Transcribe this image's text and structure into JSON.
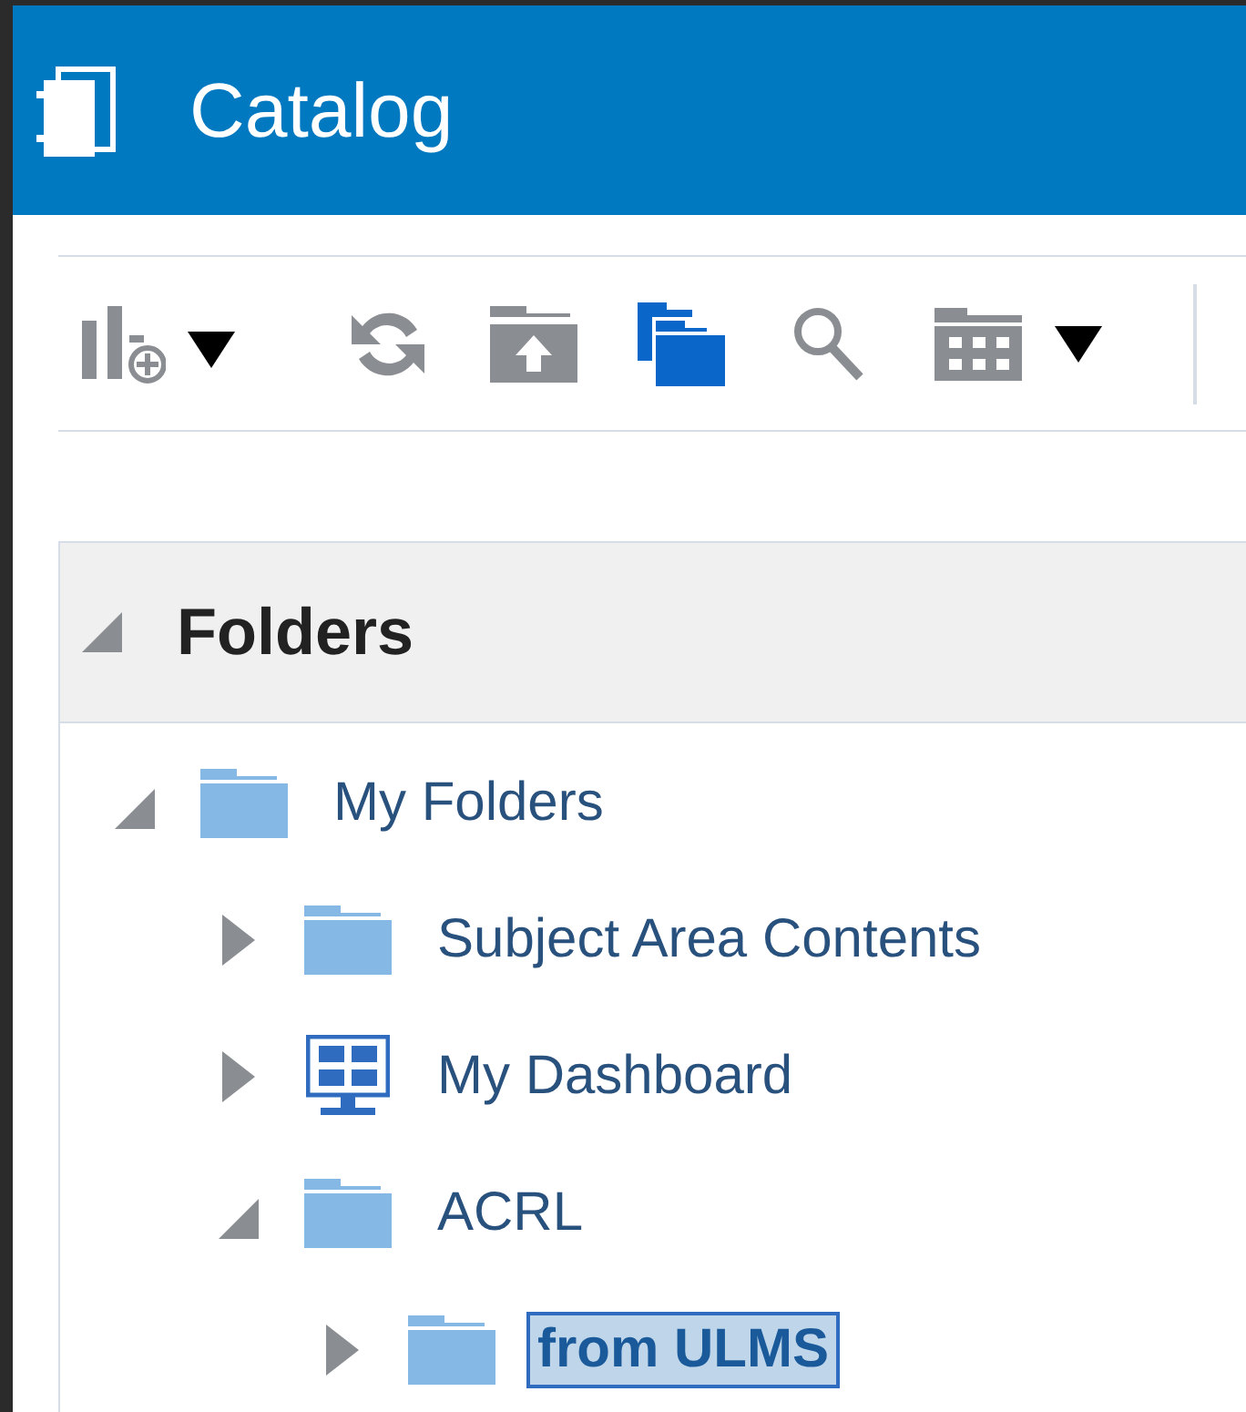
{
  "header": {
    "title": "Catalog"
  },
  "panel": {
    "title": "Folders",
    "expanded": true
  },
  "tree": [
    {
      "label": "My Folders",
      "kind": "folder",
      "expanded": true,
      "selected": false,
      "children": [
        {
          "label": "Subject Area Contents",
          "kind": "folder",
          "expanded": false,
          "selected": false
        },
        {
          "label": "My Dashboard",
          "kind": "dashboard",
          "expanded": false,
          "selected": false
        },
        {
          "label": "ACRL",
          "kind": "folder",
          "expanded": true,
          "selected": false,
          "children": [
            {
              "label": "from ULMS",
              "kind": "folder",
              "expanded": false,
              "selected": true
            }
          ]
        }
      ]
    }
  ]
}
